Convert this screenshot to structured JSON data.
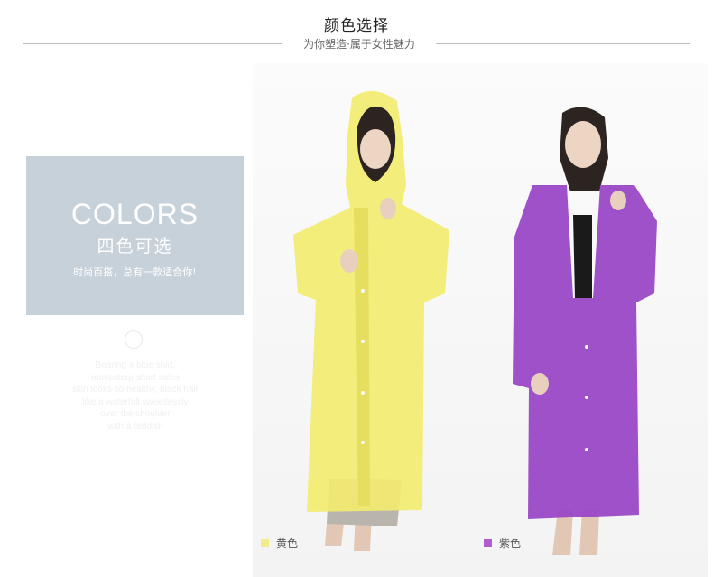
{
  "header": {
    "title": "颜色选择",
    "subtitle": "为你塑造·属于女性魅力"
  },
  "colors_panel": {
    "english_title": "COLORS",
    "chinese_title": "四色可选",
    "description": "时尚百搭，总有一款适合你!"
  },
  "background_text": {
    "lines": [
      "Bearing a blue shirt,",
      "movesterp short sales",
      "skin looks so healthy, black hair",
      "like a waterfall sweetlessly",
      "over the shoulder",
      "with a reddish"
    ]
  },
  "products": [
    {
      "label": "黄色",
      "color": "#f3ec8c"
    },
    {
      "label": "紫色",
      "color": "#b35bd0"
    }
  ],
  "colors": {
    "panel_bg": "#c7d1da",
    "yellow_raincoat": "#f0ea72",
    "purple_raincoat": "#9a48c6"
  }
}
